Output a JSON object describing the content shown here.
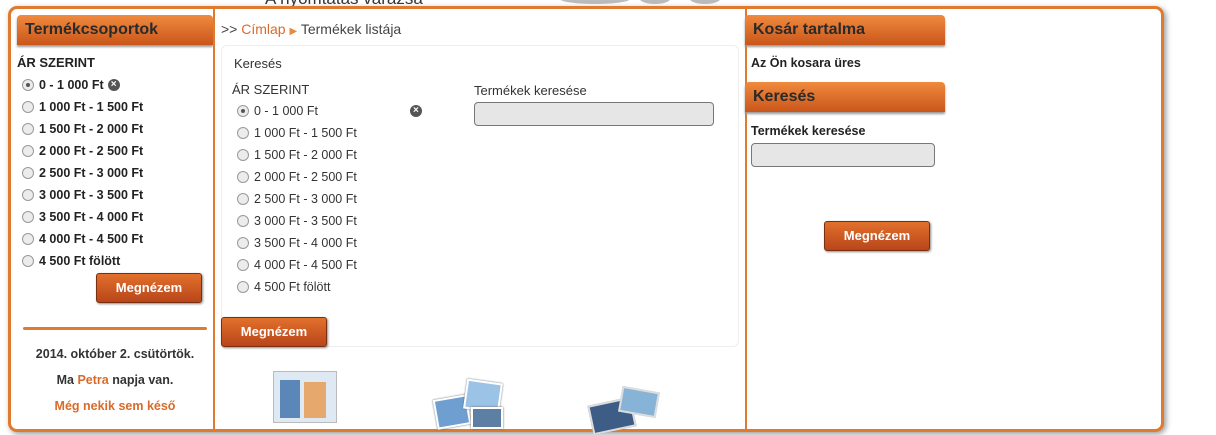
{
  "header": {
    "tagline": "A nyomtatás varázsa"
  },
  "left": {
    "title": "Termékcsoportok",
    "filter_title": "ÁR SZERINT",
    "options": [
      "0 - 1 000 Ft",
      "1 000 Ft - 1 500 Ft",
      "1 500 Ft - 2 000 Ft",
      "2 000 Ft - 2 500 Ft",
      "2 500 Ft - 3 000 Ft",
      "3 000 Ft - 3 500 Ft",
      "3 500 Ft - 4 000 Ft",
      "4 000 Ft - 4 500 Ft",
      "4 500 Ft fölött"
    ],
    "selected_index": 0,
    "button": "Megnézem",
    "date": "2014. október 2. csütörtök.",
    "nameday_prefix": "Ma",
    "nameday_name": "Petra",
    "nameday_suffix": "napja van.",
    "nameday_link": "Még nekik sem késő"
  },
  "middle": {
    "breadcrumb_prefix": ">>",
    "breadcrumb_home": "Címlap",
    "breadcrumb_current": "Termékek listája",
    "panel_title": "Keresés",
    "filter_title": "ÁR SZERINT",
    "options": [
      "0 - 1 000 Ft",
      "1 000 Ft - 1 500 Ft",
      "1 500 Ft - 2 000 Ft",
      "2 000 Ft - 2 500 Ft",
      "2 500 Ft - 3 000 Ft",
      "3 000 Ft - 3 500 Ft",
      "3 500 Ft - 4 000 Ft",
      "4 000 Ft - 4 500 Ft",
      "4 500 Ft fölött"
    ],
    "selected_index": 0,
    "search_label": "Termékek keresése",
    "search_value": "",
    "button": "Megnézem"
  },
  "right": {
    "cart_title": "Kosár tartalma",
    "cart_empty": "Az Ön kosara üres",
    "search_title": "Keresés",
    "search_label": "Termékek keresése",
    "search_value": "",
    "button": "Megnézem"
  },
  "colors": {
    "accent": "#e07a2e",
    "button": "#c85520"
  },
  "icons": {
    "clear": "close-circle-icon",
    "breadcrumb_arrow": "triangle-right-icon"
  }
}
